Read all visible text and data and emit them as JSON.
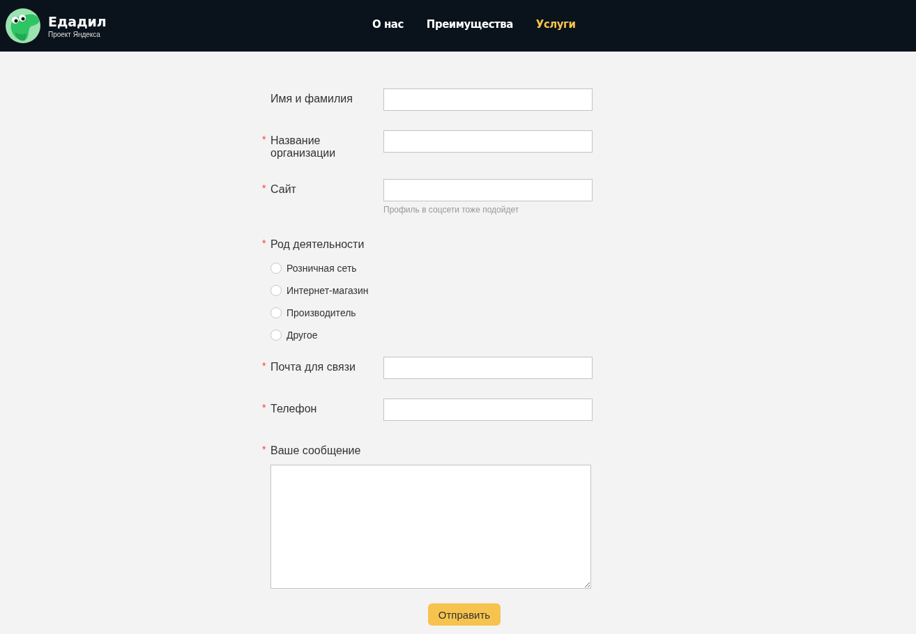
{
  "header": {
    "logo": {
      "title": "Едадил",
      "subtitle": "Проект Яндекса"
    },
    "nav": [
      {
        "label": "О нас",
        "selected": false
      },
      {
        "label": "Преимущества",
        "selected": false
      },
      {
        "label": "Услуги",
        "selected": true
      }
    ]
  },
  "form": {
    "fields": [
      {
        "kind": "text",
        "label": "Имя и фамилия"
      },
      {
        "kind": "text",
        "label": "Название организации",
        "mark": "*"
      },
      {
        "kind": "text",
        "label": "Сайт",
        "mark": "*",
        "hint": "Профиль в соцсети тоже подойдет"
      },
      {
        "kind": "radio",
        "label": "Род деятельности",
        "mark": "*",
        "options": [
          {
            "label": "Розничная сеть",
            "selected": false
          },
          {
            "label": "Интернет-магазин",
            "selected": false
          },
          {
            "label": "Производитель",
            "selected": false
          },
          {
            "label": "Другое",
            "selected": false
          }
        ]
      },
      {
        "kind": "text",
        "label": "Почта для связи",
        "mark": "*"
      },
      {
        "kind": "text",
        "label": "Телефон",
        "mark": "*"
      },
      {
        "kind": "textarea",
        "label": "Ваше сообщение",
        "mark": "*"
      }
    ],
    "submit": "Отправить"
  }
}
